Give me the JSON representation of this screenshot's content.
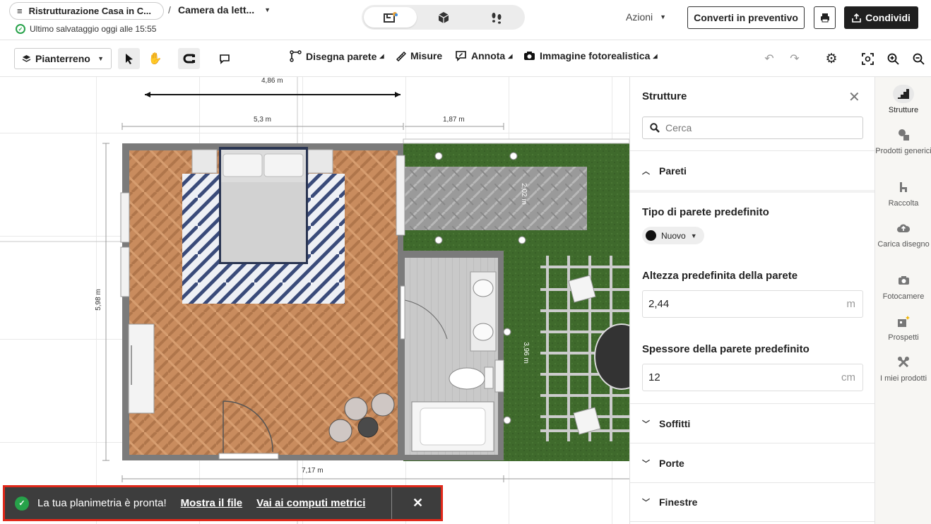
{
  "header": {
    "project_title": "Ristrutturazione Casa in C...",
    "separator": "/",
    "room_name": "Camera da lett...",
    "save_status": "Ultimo salvataggio oggi alle 15:55",
    "view_modes": [
      "2d-plan-icon",
      "3d-box-icon",
      "walk-footsteps-icon"
    ],
    "actions_label": "Azioni",
    "convert_label": "Converti in preventivo",
    "share_label": "Condividi"
  },
  "toolbar": {
    "floor_label": "Pianterreno",
    "draw_wall": "Disegna parete",
    "measures": "Misure",
    "annotate": "Annota",
    "photo": "Immagine fotorealistica"
  },
  "canvas": {
    "dimensions": [
      "4,86 m",
      "5,3 m",
      "1,87 m",
      "5,98 m",
      "7,17 m",
      "2,02 m",
      "3,96 m"
    ],
    "colors": {
      "floor_wood": "#c98c5e",
      "grass": "#3f6a2c",
      "wall": "#7b7b7b",
      "tile": "#c9c9c9"
    }
  },
  "panel": {
    "title": "Strutture",
    "search_placeholder": "Cerca",
    "walls_section": "Pareti",
    "wall_type_label": "Tipo di parete predefinito",
    "wall_type_value": "Nuovo",
    "height_label": "Altezza predefinita della parete",
    "height_value": "2,44",
    "height_unit": "m",
    "thickness_label": "Spessore della parete predefinito",
    "thickness_value": "12",
    "thickness_unit": "cm",
    "sections": [
      "Soffitti",
      "Porte",
      "Finestre"
    ]
  },
  "rightbar": {
    "items": [
      {
        "label": "Strutture",
        "icon": "stairs-icon"
      },
      {
        "label": "Prodotti generici",
        "icon": "furniture-icon"
      },
      {
        "label": "Raccolta",
        "icon": "chair-icon"
      },
      {
        "label": "Carica disegno",
        "icon": "upload-cloud-icon"
      },
      {
        "label": "Fotocamere",
        "icon": "camera-icon"
      },
      {
        "label": "Prospetti",
        "icon": "elevation-icon"
      },
      {
        "label": "I miei prodotti",
        "icon": "tools-icon"
      }
    ]
  },
  "toast": {
    "message": "La tua planimetria è pronta!",
    "link1": "Mostra il file",
    "link2": "Vai ai computi metrici"
  }
}
